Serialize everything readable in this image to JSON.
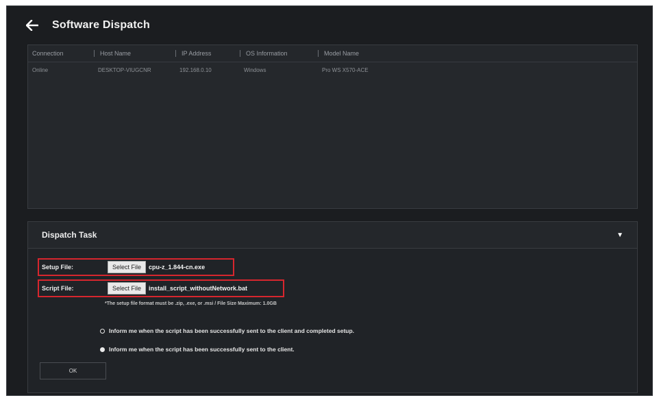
{
  "header": {
    "title": "Software Dispatch"
  },
  "table": {
    "columns": [
      "Connection",
      "Host Name",
      "IP Address",
      "OS Information",
      "Model Name"
    ],
    "rows": [
      [
        "Online",
        "DESKTOP-VIUGCNR",
        "192.168.0.10",
        "Windows",
        "Pro WS X570-ACE"
      ]
    ]
  },
  "task": {
    "title": "Dispatch Task",
    "setup_label": "Setup File:",
    "script_label": "Script File:",
    "select_label": "Select File",
    "setup_file": "cpu-z_1.844-cn.exe",
    "script_file": "install_script_withoutNetwork.bat",
    "note": "*The setup file format must be .zip, .exe, or .msi  /  File Size Maximum: 1.0GB",
    "option1": "Inform me when the script has been successfully sent to the client and completed setup.",
    "option2": "Inform me when the script has been successfully sent to the client.",
    "ok_label": "OK"
  },
  "colors": {
    "highlight": "#d8262e",
    "background": "#1b1d20"
  }
}
